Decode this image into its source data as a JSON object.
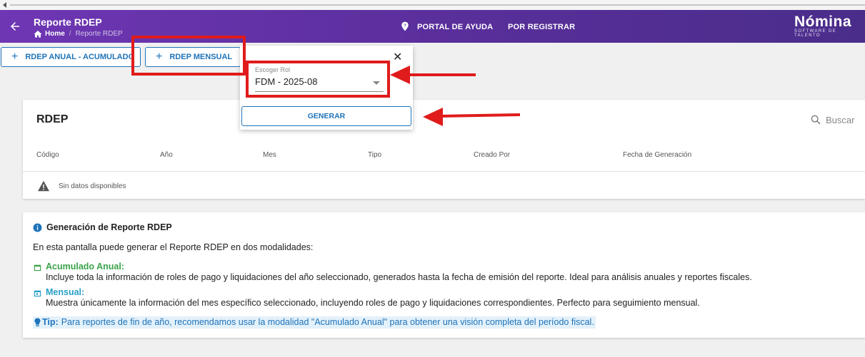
{
  "header": {
    "title": "Reporte RDEP",
    "breadcrumb": {
      "home": "Home",
      "current": "Reporte RDEP"
    },
    "nav": {
      "help": "PORTAL DE AYUDA",
      "register": "POR REGISTRAR"
    },
    "logo": {
      "name": "Nómina",
      "tagline": "SOFTWARE DE TALENTO"
    }
  },
  "toolbar": {
    "annual_button": "RDEP ANUAL - ACUMULADO",
    "monthly_button": "RDEP MENSUAL"
  },
  "popup": {
    "select_label": "Escoger Rol",
    "select_value": "FDM - 2025-08",
    "generate_button": "GENERAR"
  },
  "table": {
    "title": "RDEP",
    "search_placeholder": "Buscar",
    "columns": [
      "Código",
      "Año",
      "Mes",
      "Tipo",
      "Creado Por",
      "Fecha de Generación"
    ],
    "empty_text": "Sin datos disponibles"
  },
  "info": {
    "title": "Generación de Reporte RDEP",
    "intro": "En esta pantalla puede generar el Reporte RDEP en dos modalidades:",
    "annual_title": "Acumulado Anual:",
    "annual_desc": "Incluye toda la información de roles de pago y liquidaciones del año seleccionado, generados hasta la fecha de emisión del reporte. Ideal para análisis anuales y reportes fiscales.",
    "monthly_title": "Mensual:",
    "monthly_desc": "Muestra únicamente la información del mes específico seleccionado, incluyendo roles de pago y liquidaciones correspondientes. Perfecto para seguimiento mensual.",
    "tip_label": "Tip:",
    "tip_text": "Para reportes de fin de año, recomendamos usar la modalidad \"Acumulado Anual\" para obtener una visión completa del período fiscal."
  },
  "colors": {
    "header": "#5a2f9c",
    "primary": "#1e73b9",
    "annotation": "#e01b1b",
    "green": "#3aa34a",
    "teal": "#29a0c8"
  }
}
